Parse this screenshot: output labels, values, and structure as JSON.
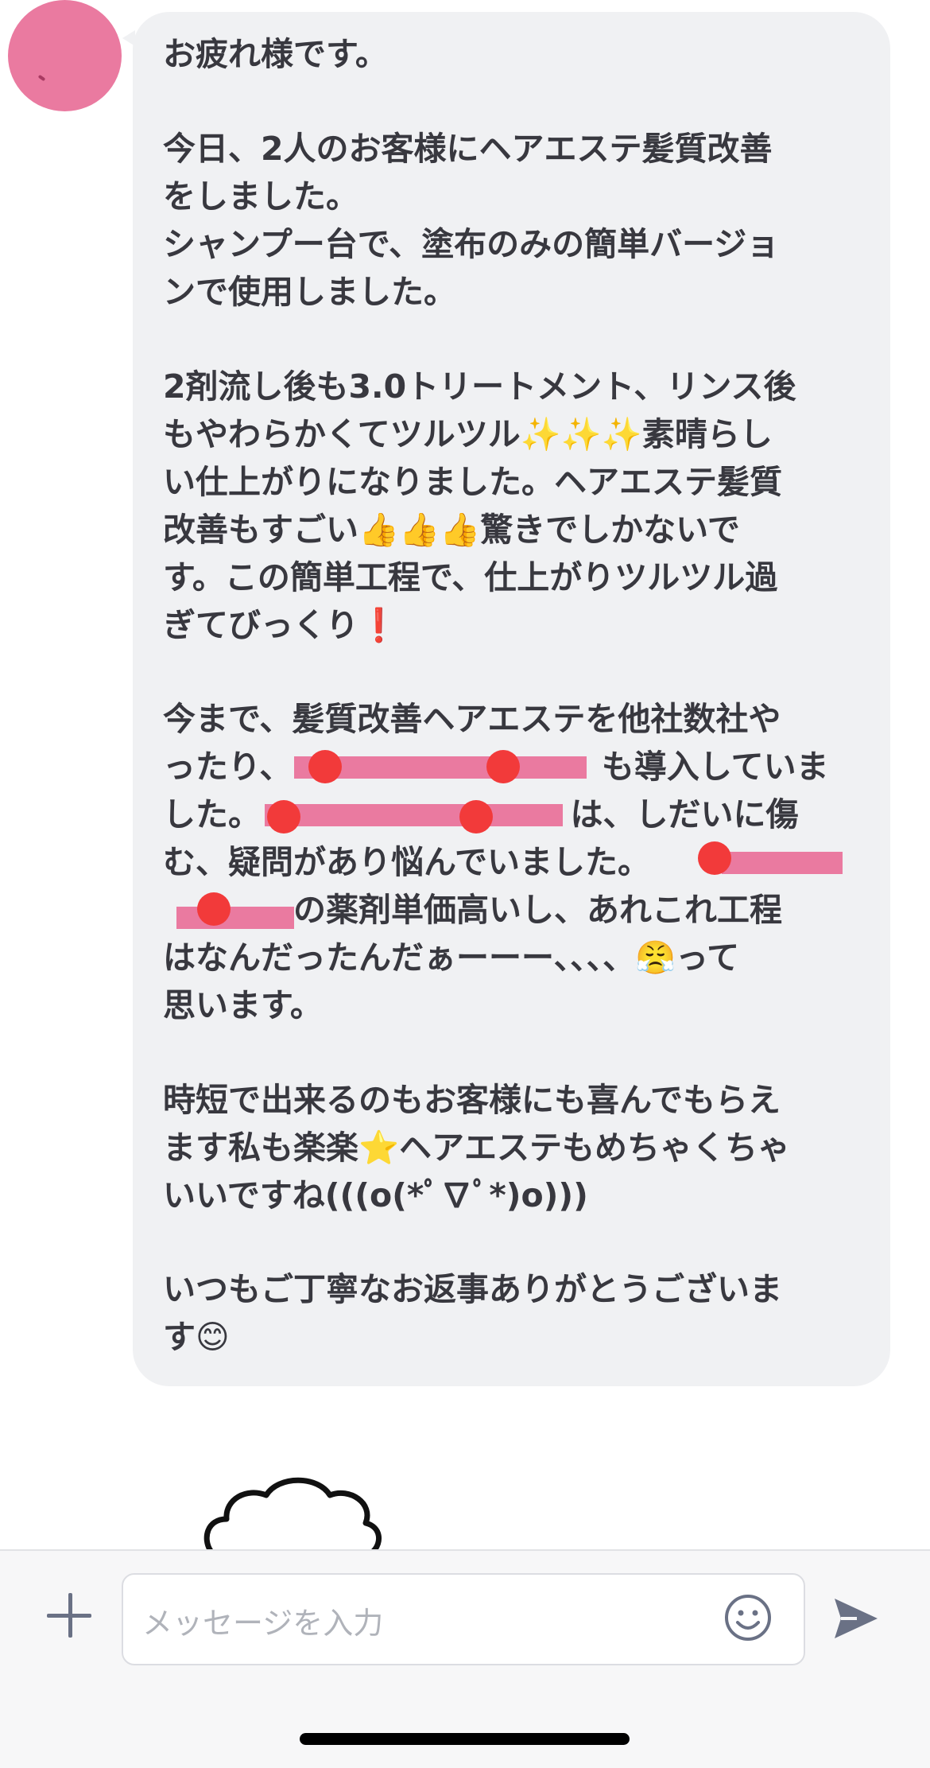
{
  "message": {
    "lines": [
      "お疲れ様です。",
      "今日、2人のお客様にヘアエステ髪質改善",
      "をしました。",
      "シャンプー台で、塗布のみの簡単バージョ",
      "ンで使用しました。",
      "2剤流し後も3.0トリートメント、リンス後",
      "もやわらかくてツルツル✨✨✨素晴らし",
      "い仕上がりになりました。ヘアエステ髪質",
      "改善もすごい👍👍👍驚きでしかないで",
      "す。この簡単工程で、仕上がりツルツル過",
      "ぎてびっくり❗",
      "今まで、髪質改善ヘアエステを他社数社や",
      "ったり、　　　　　　　　　　も導入していま",
      "した。　　　　　　　　　　は、しだいに傷",
      "む、疑問があり悩んでいました。　　　　",
      "　　　　の薬剤単価高いし、あれこれ工程",
      "はなんだったんだぁーーー、、、、😤って",
      "思います。",
      "時短で出来るのもお客様にも喜んでもらえ",
      "ます私も楽楽⭐ヘアエステもめちゃくちゃ",
      "いいですね(((o(*ﾟ∇ﾟ*)o)))",
      "いつもご丁寧なお返事ありがとうございま",
      "す😊"
    ]
  },
  "composer": {
    "placeholder": "メッセージを入力"
  },
  "icons": {
    "attach": "plus-icon",
    "emoji": "smiley-icon",
    "send": "send-arrow-icon"
  },
  "colors": {
    "avatar": "#ea7aa0",
    "bubble": "#f0f1f3",
    "redaction": "#ea7aa0",
    "redaction_dot": "#f23a3a",
    "icon": "#6a7185"
  }
}
